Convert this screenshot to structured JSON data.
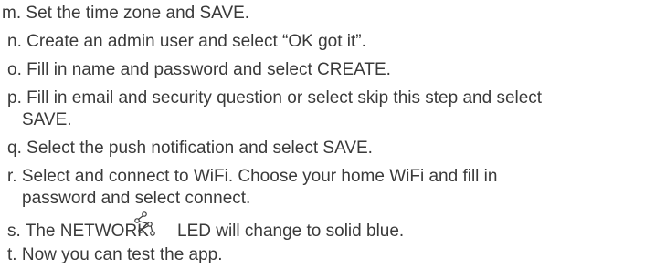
{
  "steps": [
    {
      "letter": "m.",
      "text": "Set the time zone and SAVE."
    },
    {
      "letter": "n.",
      "text": "Create an admin user and select “OK got it”."
    },
    {
      "letter": "o.",
      "text": "Fill in name and password and select CREATE."
    },
    {
      "letter": "p.",
      "text": "Fill in email and security question or select skip this step and select",
      "cont": "SAVE."
    },
    {
      "letter": "q.",
      "text": "Select the push notification and select SAVE."
    },
    {
      "letter": "r.",
      "text": "Select and connect to WiFi. Choose your home WiFi and fill in",
      "cont": "password and select connect."
    },
    {
      "letter": "s.",
      "text_before": "The NETWORK",
      "icon": "network-icon",
      "text_after": "LED  will change to solid blue."
    },
    {
      "letter": "t.",
      "text": "Now you can test the app."
    }
  ]
}
